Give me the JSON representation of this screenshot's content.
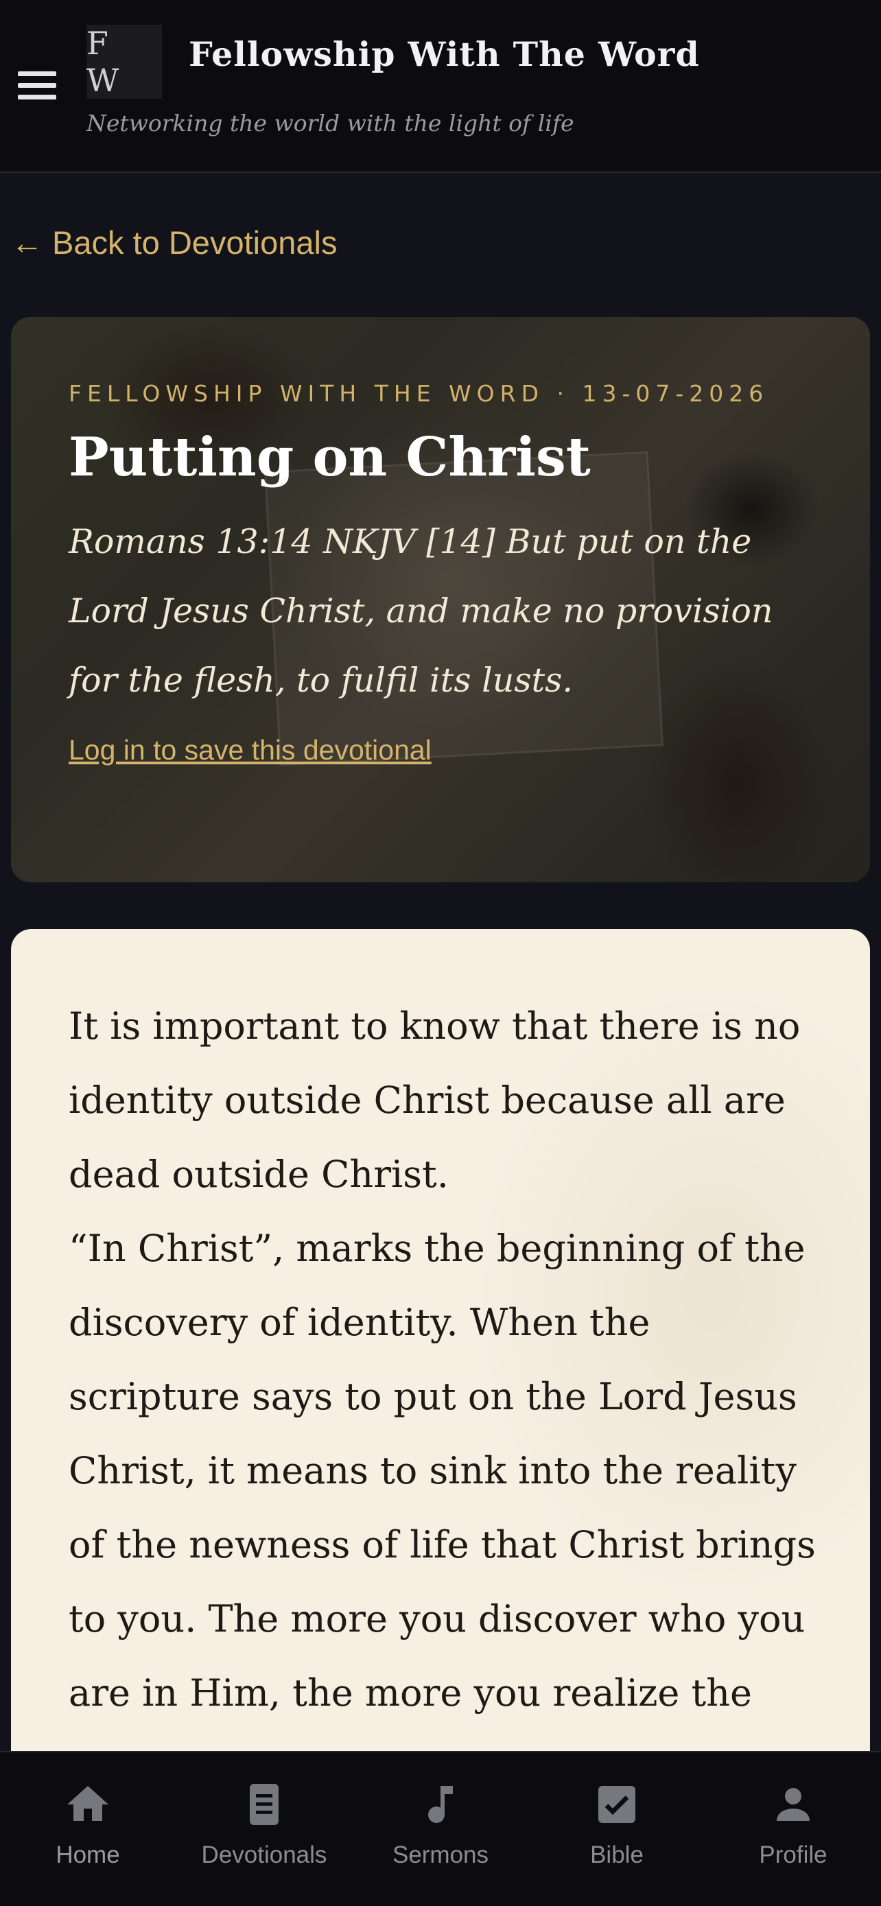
{
  "header": {
    "logo_text": "F W",
    "title": "Fellowship With The Word",
    "tagline": "Networking the world with the light of life"
  },
  "nav": {
    "back_label": "← Back to Devotionals"
  },
  "hero": {
    "kicker": "FELLOWSHIP WITH THE WORD · 13-07-2026",
    "title": "Putting on Christ",
    "verse": "Romans 13:14 NKJV [14] But put on the Lord Jesus Christ, and make no provision for the flesh, to fulfil its lusts.",
    "save_label": "Log in to save this devotional"
  },
  "body": {
    "paragraphs": [
      "It is important to know that there is no identity outside Christ because all are dead outside Christ.",
      "“In Christ”, marks the beginning of the discovery of identity. When the scripture says to put on the Lord Jesus Christ, it means to sink into the reality of the newness of life that Christ brings to you. The more you discover who you are in Him, the more you realize the"
    ]
  },
  "bottom_nav": [
    {
      "label": "Home",
      "icon": "home-icon"
    },
    {
      "label": "Devotionals",
      "icon": "book-icon"
    },
    {
      "label": "Sermons",
      "icon": "music-note-icon"
    },
    {
      "label": "Bible",
      "icon": "checkbox-icon"
    },
    {
      "label": "Profile",
      "icon": "person-icon"
    }
  ]
}
